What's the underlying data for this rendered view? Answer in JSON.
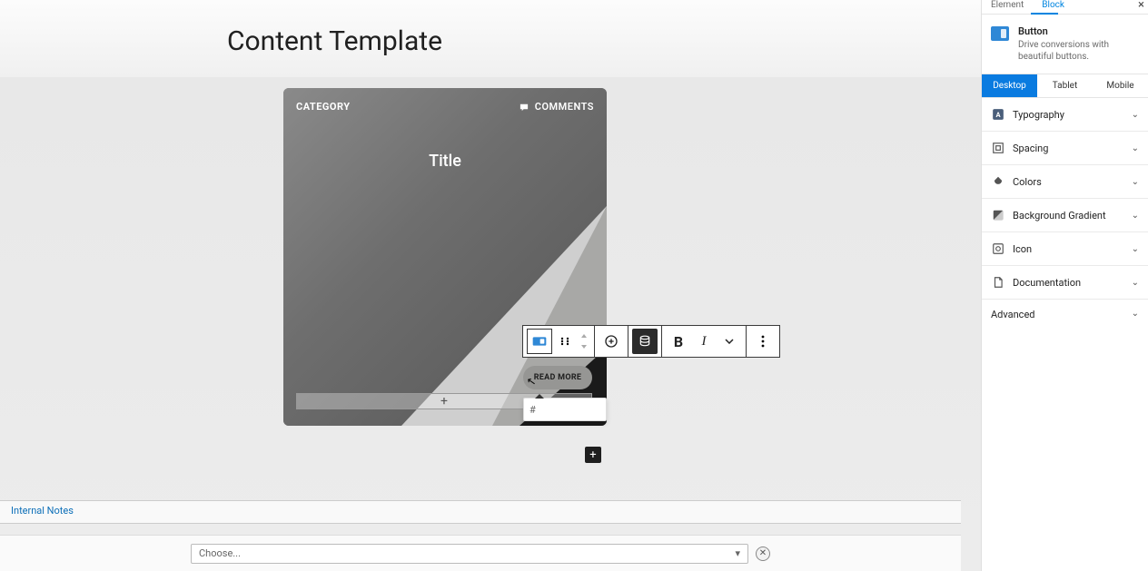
{
  "page_title": "Content Template",
  "card": {
    "category_label": "CATEGORY",
    "comments_label": "COMMENTS",
    "title": "Title"
  },
  "button_block": {
    "label": "READ MORE",
    "url_placeholder": "#"
  },
  "add_inline": "+",
  "add_block": "+",
  "toolbar": {
    "bold": "B",
    "italic": "I"
  },
  "footer": {
    "internal_notes": "Internal Notes"
  },
  "bottom": {
    "choose_placeholder": "Choose..."
  },
  "sidebar": {
    "tabs": {
      "element": "Element",
      "block": "Block",
      "active": "Block"
    },
    "block": {
      "name": "Button",
      "description": "Drive conversions with beautiful buttons."
    },
    "devices": {
      "desktop": "Desktop",
      "tablet": "Tablet",
      "mobile": "Mobile",
      "active": "Desktop"
    },
    "panels": [
      {
        "label": "Typography",
        "icon": "type"
      },
      {
        "label": "Spacing",
        "icon": "spacing"
      },
      {
        "label": "Colors",
        "icon": "colors"
      },
      {
        "label": "Background Gradient",
        "icon": "gradient"
      },
      {
        "label": "Icon",
        "icon": "icon"
      },
      {
        "label": "Documentation",
        "icon": "doc"
      }
    ],
    "advanced": "Advanced"
  }
}
